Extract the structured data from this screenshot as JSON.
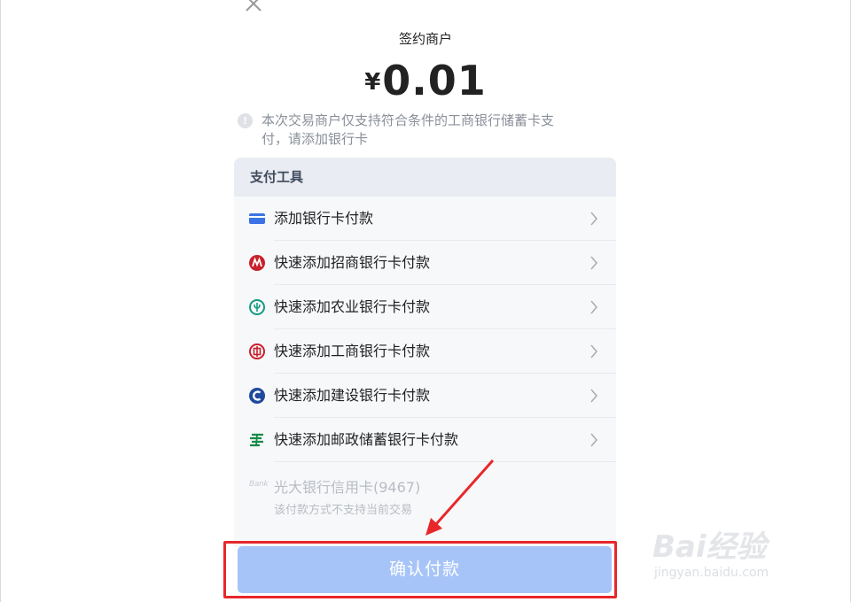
{
  "header": {
    "close_icon": "close-icon",
    "merchant": "签约商户",
    "currency_symbol": "¥",
    "amount": "0.01"
  },
  "notice": {
    "icon": "info-icon",
    "icon_glyph": "!",
    "text_line1": "本次交易商户仅支持符合条件的工商银行储蓄卡支",
    "text_line2": "付，请添加银行卡"
  },
  "payment_tools": {
    "title": "支付工具",
    "items": [
      {
        "label": "添加银行卡付款",
        "icon": "bank-card-icon",
        "color": "#3b73e6"
      },
      {
        "label": "快速添加招商银行卡付款",
        "icon": "cmb-logo-icon",
        "color": "#c8202b"
      },
      {
        "label": "快速添加农业银行卡付款",
        "icon": "abc-logo-icon",
        "color": "#149a83"
      },
      {
        "label": "快速添加工商银行卡付款",
        "icon": "icbc-logo-icon",
        "color": "#c8202b"
      },
      {
        "label": "快速添加建设银行卡付款",
        "icon": "ccb-logo-icon",
        "color": "#1f4a9c"
      },
      {
        "label": "快速添加邮政储蓄银行卡付款",
        "icon": "psbc-logo-icon",
        "color": "#138a46"
      }
    ],
    "disabled_item": {
      "icon_text": "Bank",
      "label": "光大银行信用卡(9467)",
      "sub": "该付款方式不支持当前交易"
    }
  },
  "confirm_button": {
    "label": "确认付款",
    "color": "#a6c4f7"
  },
  "annotation": {
    "highlight_color": "#e8272b"
  },
  "watermark": {
    "brand": "Bai经验",
    "url": "jingyan.baidu.com"
  }
}
